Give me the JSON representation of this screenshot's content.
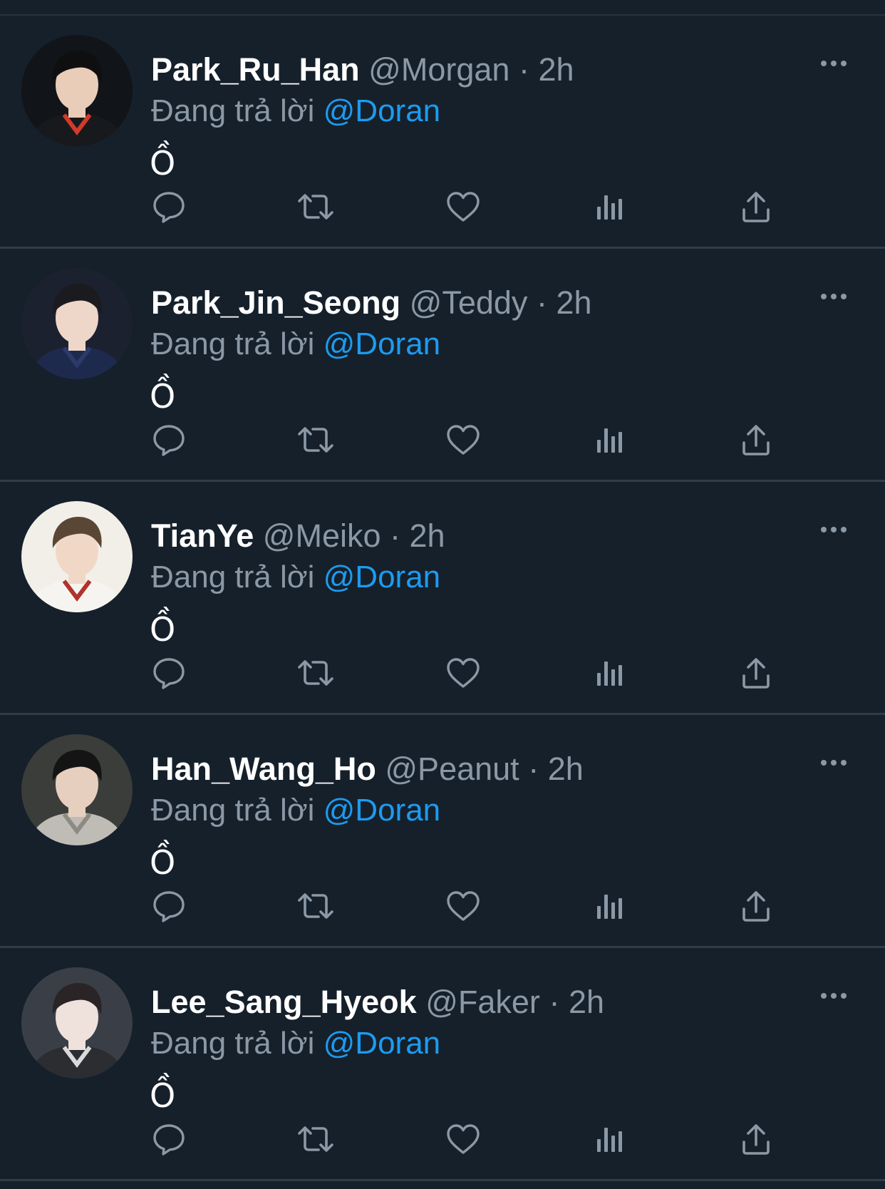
{
  "tweets": [
    {
      "display_name": "Park_Ru_Han",
      "handle": "@Morgan",
      "separator": "·",
      "time": "2h",
      "reply_prefix": "Đang trả lời",
      "reply_to": "@Doran",
      "text": "Ồ",
      "avatar": {
        "bg": "#111418",
        "skin": "#e9cdb8",
        "hair": "#0f0f10",
        "shirt": "#18191c",
        "accent": "#d23a2a"
      }
    },
    {
      "display_name": "Park_Jin_Seong",
      "handle": "@Teddy",
      "separator": "·",
      "time": "2h",
      "reply_prefix": "Đang trả lời",
      "reply_to": "@Doran",
      "text": "Ồ",
      "avatar": {
        "bg": "#1c2130",
        "skin": "#eed7c8",
        "hair": "#1b1b1f",
        "shirt": "#1e2a4d",
        "accent": "#2c3a6b"
      }
    },
    {
      "display_name": "TianYe",
      "handle": "@Meiko",
      "separator": "·",
      "time": "2h",
      "reply_prefix": "Đang trả lời",
      "reply_to": "@Doran",
      "text": "Ồ",
      "avatar": {
        "bg": "#f2efe9",
        "skin": "#f1d8c6",
        "hair": "#5a4634",
        "shirt": "#f6f4f0",
        "accent": "#b0332c"
      }
    },
    {
      "display_name": "Han_Wang_Ho",
      "handle": "@Peanut",
      "separator": "·",
      "time": "2h",
      "reply_prefix": "Đang trả lời",
      "reply_to": "@Doran",
      "text": "Ồ",
      "avatar": {
        "bg": "#3b3d3a",
        "skin": "#e7cfbf",
        "hair": "#141414",
        "shirt": "#bfbcb6",
        "accent": "#8d8a84"
      }
    },
    {
      "display_name": "Lee_Sang_Hyeok",
      "handle": "@Faker",
      "separator": "·",
      "time": "2h",
      "reply_prefix": "Đang trả lời",
      "reply_to": "@Doran",
      "text": "Ồ",
      "avatar": {
        "bg": "#3a3f47",
        "skin": "#efe2dc",
        "hair": "#2a2426",
        "shirt": "#2b2d31",
        "accent": "#d9d9d9"
      }
    }
  ],
  "icons": {
    "more": "more-icon",
    "reply": "reply-icon",
    "retweet": "retweet-icon",
    "like": "like-icon",
    "views": "views-icon",
    "share": "share-icon"
  },
  "colors": {
    "background": "#15202b",
    "divider": "#2f3d4a",
    "secondary_text": "#8b98a5",
    "accent": "#1d9bf0",
    "icon": "#8b98a5"
  }
}
